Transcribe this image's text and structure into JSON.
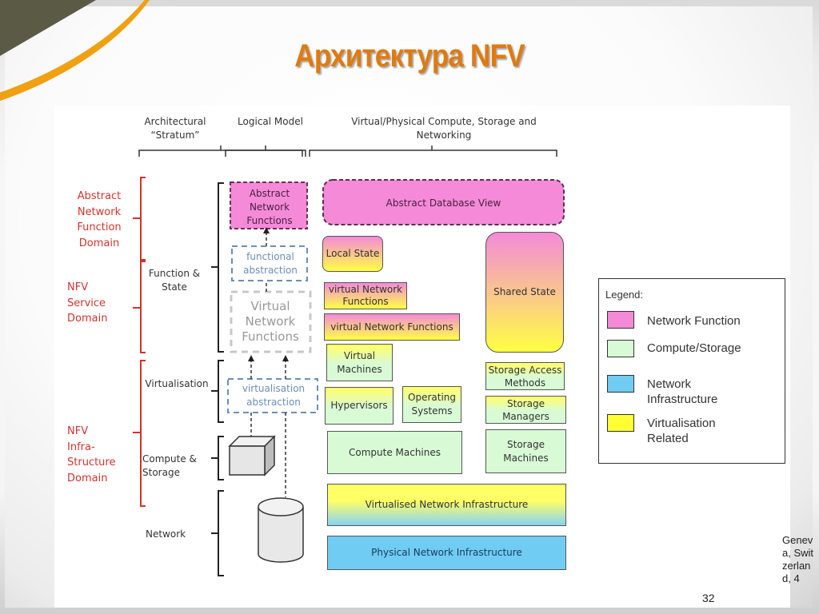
{
  "slide": {
    "title": "Архитектура NFV",
    "page_number": "32",
    "footer_location": "Geneva, Switzerland, 4"
  },
  "columns": {
    "stratum": "Architectural “Stratum”",
    "logical": "Logical Model",
    "physical": "Virtual/Physical Compute, Storage and Networking"
  },
  "domains": [
    {
      "label": "Abstract Network Function Domain"
    },
    {
      "label": "NFV Service Domain"
    },
    {
      "label": "NFV Infra-Structure Domain"
    }
  ],
  "strata": [
    {
      "label": "Function & State"
    },
    {
      "label": "Virtualisation"
    },
    {
      "label": "Compute & Storage"
    },
    {
      "label": "Network"
    }
  ],
  "logical_model": {
    "abstract_nf": "Abstract Network Functions",
    "functional_abstraction": "functional abstraction",
    "virtual_nf": "Virtual Network Functions",
    "virtualisation_abstraction": "virtualisation abstraction",
    "compute_icon": "cube-icon",
    "network_icon": "cylinder-icon"
  },
  "physical_boxes": {
    "abstract_db_view": "Abstract Database View",
    "local_state": "Local State",
    "shared_state": "Shared State",
    "vnf_small": "virtual Network Functions",
    "vnf_wide": "virtual Network Functions",
    "virtual_machines": "Virtual Machines",
    "hypervisors": "Hypervisors",
    "operating_systems": "Operating Systems",
    "storage_access_methods": "Storage Access Methods",
    "storage_managers": "Storage Managers",
    "compute_machines": "Compute Machines",
    "storage_machines": "Storage Machines",
    "virtualised_network_infra": "Virtualised Network Infrastructure",
    "physical_network_infra": "Physical Network Infrastructure"
  },
  "legend": {
    "title": "Legend:",
    "items": [
      {
        "label": "Network Function",
        "color": "#f48ad8"
      },
      {
        "label": "Compute/Storage",
        "color": "#d8fbd6"
      },
      {
        "label": "Network Infrastructure",
        "color": "#70ccf2"
      },
      {
        "label": "Virtualisation Related",
        "color": "#ffff33"
      }
    ]
  },
  "colors": {
    "title": "#e07a10",
    "domain_text": "#d0342c",
    "network_function": "#f48ad8",
    "compute_storage": "#d8fbd6",
    "network_infra": "#70ccf2",
    "virtualisation": "#ffff33",
    "abstraction_dash": "#6b8fb5"
  }
}
